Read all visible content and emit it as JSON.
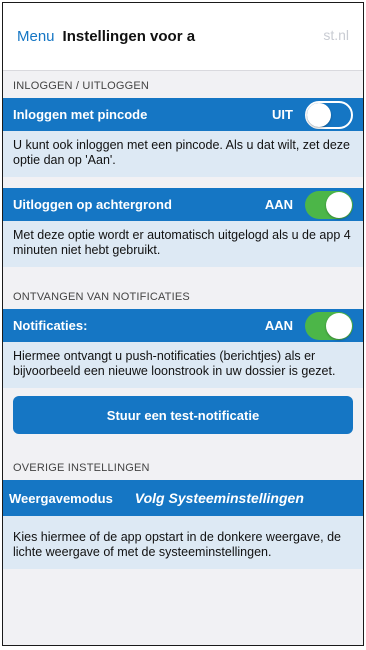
{
  "nav": {
    "menu_label": "Menu",
    "title": "Instellingen voor a",
    "domain_fragment": "st.nl"
  },
  "sections": {
    "login_header": "INLOGGEN / UITLOGGEN",
    "notifications_header": "ONTVANGEN VAN NOTIFICATIES",
    "other_header": "OVERIGE INSTELLINGEN"
  },
  "pin": {
    "label": "Inloggen met pincode",
    "state": "UIT",
    "enabled": false,
    "description": "U kunt ook inloggen met een pincode. Als u dat wilt, zet deze optie dan op 'Aan'."
  },
  "background_logout": {
    "label": "Uitloggen op achtergrond",
    "state": "AAN",
    "enabled": true,
    "description": "Met deze optie wordt er automatisch uitgelogd als u de app 4 minuten niet hebt gebruikt."
  },
  "notifications": {
    "label": "Notificaties:",
    "state": "AAN",
    "enabled": true,
    "description": "Hiermee ontvangt u push-notificaties (berichtjes) als er bijvoorbeeld een nieuwe loonstrook in uw dossier is gezet.",
    "test_button": "Stuur een test-notificatie"
  },
  "display_mode": {
    "label": "Weergavemodus",
    "value": "Volg Systeeminstellingen",
    "description": "Kies hiermee of de app opstart in de donkere weergave, de lichte weergave of met de systeeminstellingen."
  },
  "colors": {
    "accent": "#1576c4",
    "toggle_on": "#4cb648",
    "description_bg": "#dde9f4"
  }
}
